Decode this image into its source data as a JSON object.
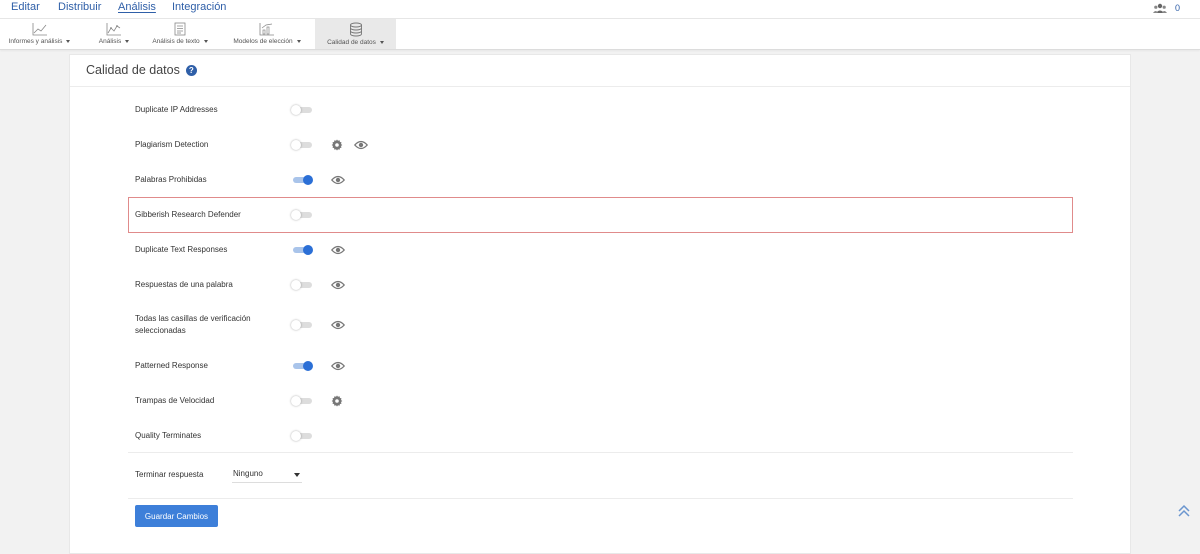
{
  "topnav": {
    "items": [
      "Editar",
      "Distribuir",
      "Análisis",
      "Integración"
    ],
    "active_index": 2,
    "user_count": "0"
  },
  "toolbar": {
    "tools": [
      {
        "label": "Informes y análisis",
        "icon": "line-chart-icon"
      },
      {
        "label": "Análisis",
        "icon": "analysis-chart-icon"
      },
      {
        "label": "Análisis de texto",
        "icon": "text-analysis-icon"
      },
      {
        "label": "Modelos de elección",
        "icon": "choice-model-icon"
      },
      {
        "label": "Calidad de datos",
        "icon": "database-icon"
      }
    ],
    "active_index": 4
  },
  "panel": {
    "title": "Calidad de datos"
  },
  "settings": [
    {
      "label": "Duplicate IP Addresses",
      "on": false,
      "icons": []
    },
    {
      "label": "Plagiarism Detection",
      "on": false,
      "icons": [
        "gear-icon",
        "eye-icon"
      ]
    },
    {
      "label": "Palabras Prohibidas",
      "on": true,
      "icons": [
        "eye-icon"
      ]
    },
    {
      "label": "Gibberish Research Defender",
      "on": false,
      "icons": [],
      "highlighted": true
    },
    {
      "label": "Duplicate Text Responses",
      "on": true,
      "icons": [
        "eye-icon"
      ]
    },
    {
      "label": "Respuestas de una palabra",
      "on": false,
      "icons": [
        "eye-icon"
      ]
    },
    {
      "label": "Todas las casillas de verificación seleccionadas",
      "on": false,
      "icons": [
        "eye-icon"
      ]
    },
    {
      "label": "Patterned Response",
      "on": true,
      "icons": [
        "eye-icon"
      ]
    },
    {
      "label": "Trampas de Velocidad",
      "on": false,
      "icons": [
        "gear-icon"
      ]
    },
    {
      "label": "Quality Terminates",
      "on": false,
      "icons": []
    }
  ],
  "terminate": {
    "label": "Terminar respuesta",
    "value": "Ninguno"
  },
  "save_button": "Guardar Cambios",
  "colors": {
    "accent": "#2b6fd6",
    "button": "#3d7fd9",
    "nav_text": "#2f5fa8",
    "highlight_border": "#e08b8b"
  }
}
